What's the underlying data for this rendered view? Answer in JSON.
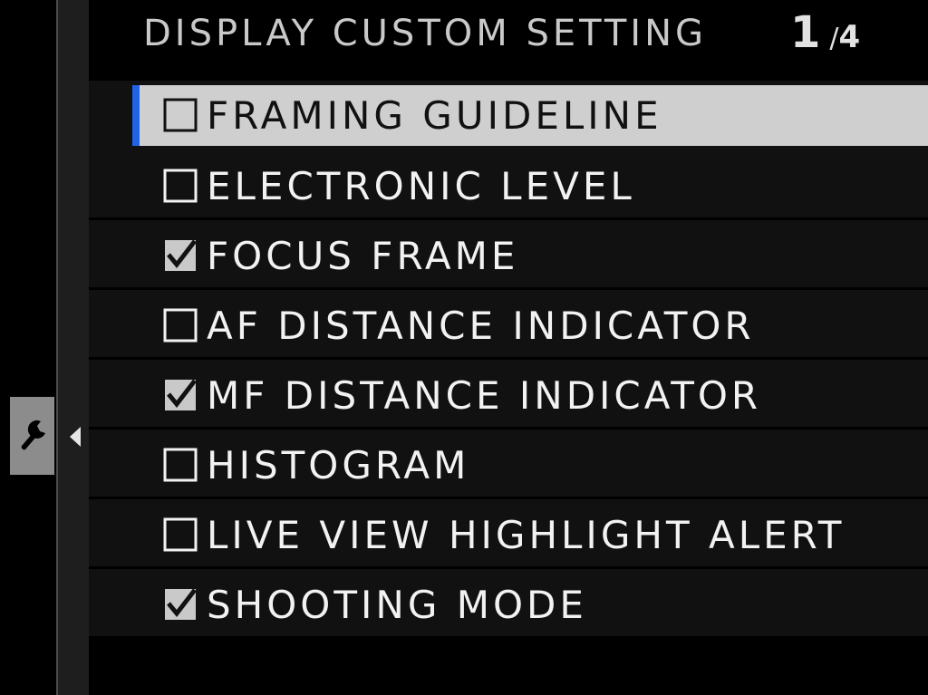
{
  "header": {
    "title": "DISPLAY CUSTOM SETTING",
    "page_current": "1",
    "page_separator": "/",
    "page_total": "4"
  },
  "sidebar": {
    "active_tab_icon": "wrench-icon"
  },
  "menu": {
    "items": [
      {
        "label": "FRAMING GUIDELINE",
        "checked": false,
        "selected": true
      },
      {
        "label": "ELECTRONIC LEVEL",
        "checked": false,
        "selected": false
      },
      {
        "label": "FOCUS FRAME",
        "checked": true,
        "selected": false
      },
      {
        "label": "AF DISTANCE INDICATOR",
        "checked": false,
        "selected": false
      },
      {
        "label": "MF DISTANCE INDICATOR",
        "checked": true,
        "selected": false
      },
      {
        "label": "HISTOGRAM",
        "checked": false,
        "selected": false
      },
      {
        "label": "LIVE VIEW HIGHLIGHT ALERT",
        "checked": false,
        "selected": false
      },
      {
        "label": "SHOOTING MODE",
        "checked": true,
        "selected": false
      }
    ]
  },
  "colors": {
    "selection_bg": "#cfcfcf",
    "selection_accent": "#1f63e6",
    "row_bg": "#111111",
    "background": "#000000"
  }
}
